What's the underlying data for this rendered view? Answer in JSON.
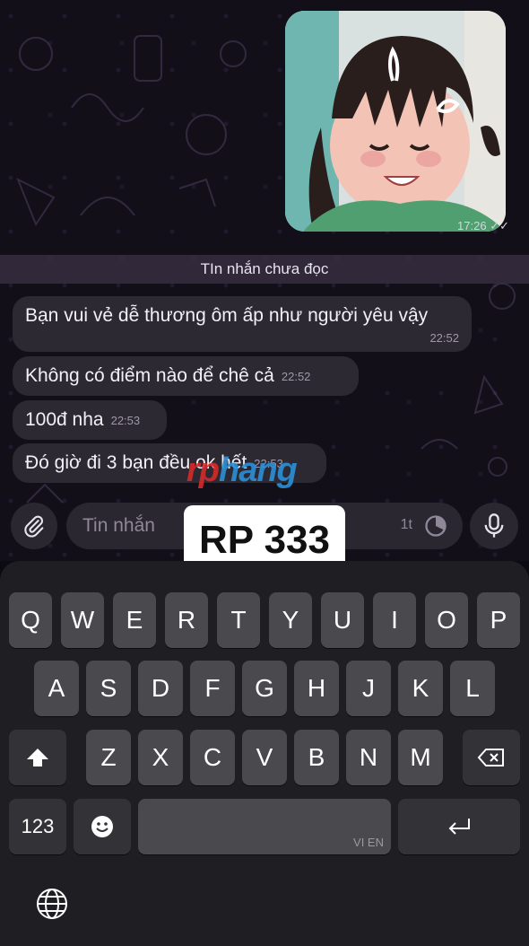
{
  "photo": {
    "time": "17:26"
  },
  "unread_label": "TIn nhắn chưa đọc",
  "messages": [
    {
      "text": "Bạn vui vẻ dễ thương ôm ấp như người yêu vậy",
      "time": "22:52"
    },
    {
      "text": "Không có điểm nào để chê cả",
      "time": "22:52"
    },
    {
      "text": "100đ nha",
      "time": "22:53"
    },
    {
      "text": "Đó giờ đi 3 bạn đều ok hết",
      "time": "22:53"
    }
  ],
  "watermark": {
    "part1": "rp",
    "part2": "hang"
  },
  "input": {
    "placeholder": "Tin nhắn",
    "timer": "1t"
  },
  "badge": "RP 333",
  "keyboard": {
    "row1": [
      "Q",
      "W",
      "E",
      "R",
      "T",
      "Y",
      "U",
      "I",
      "O",
      "P"
    ],
    "row2": [
      "A",
      "S",
      "D",
      "F",
      "G",
      "H",
      "J",
      "K",
      "L"
    ],
    "row3": [
      "Z",
      "X",
      "C",
      "V",
      "B",
      "N",
      "M"
    ],
    "numbers_label": "123",
    "space_lang": "VI EN"
  },
  "colors": {
    "bubble": "#2c2933",
    "keyboard_bg": "#1f1e22",
    "key": "#4a494e",
    "watermark_blue": "#2b8fd6",
    "watermark_red": "#d62b2b"
  }
}
